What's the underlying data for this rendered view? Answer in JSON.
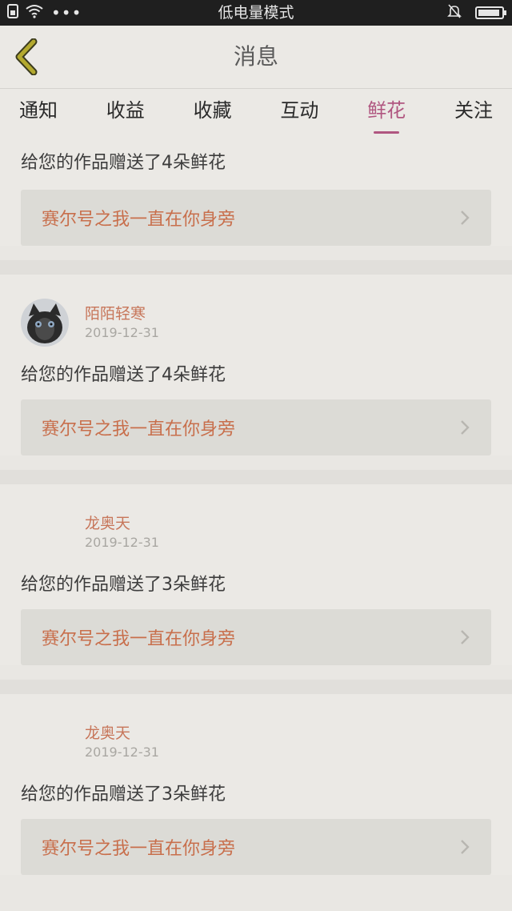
{
  "status_bar": {
    "center_text": "低电量模式",
    "icons": [
      "sim-icon",
      "wifi-icon",
      "more-dots-icon",
      "mute-bell-icon",
      "battery-icon"
    ],
    "dots": "•••"
  },
  "header": {
    "title": "消息"
  },
  "tabs": [
    {
      "label": "通知",
      "active": false
    },
    {
      "label": "收益",
      "active": false
    },
    {
      "label": "收藏",
      "active": false
    },
    {
      "label": "互动",
      "active": false
    },
    {
      "label": "鲜花",
      "active": true
    },
    {
      "label": "关注",
      "active": false
    }
  ],
  "colors": {
    "accent": "#b05680",
    "link_text": "#c86f4c",
    "username": "#c7765a"
  },
  "feed": [
    {
      "username": "",
      "date": "",
      "message": "给您的作品赠送了4朵鲜花",
      "work_title": "赛尔号之我一直在你身旁",
      "has_avatar": false
    },
    {
      "username": "陌陌轻寒",
      "date": "2019-12-31",
      "message": "给您的作品赠送了4朵鲜花",
      "work_title": "赛尔号之我一直在你身旁",
      "has_avatar": true
    },
    {
      "username": "龙奥天",
      "date": "2019-12-31",
      "message": "给您的作品赠送了3朵鲜花",
      "work_title": "赛尔号之我一直在你身旁",
      "has_avatar": false
    },
    {
      "username": "龙奥天",
      "date": "2019-12-31",
      "message": "给您的作品赠送了3朵鲜花",
      "work_title": "赛尔号之我一直在你身旁",
      "has_avatar": false
    }
  ]
}
